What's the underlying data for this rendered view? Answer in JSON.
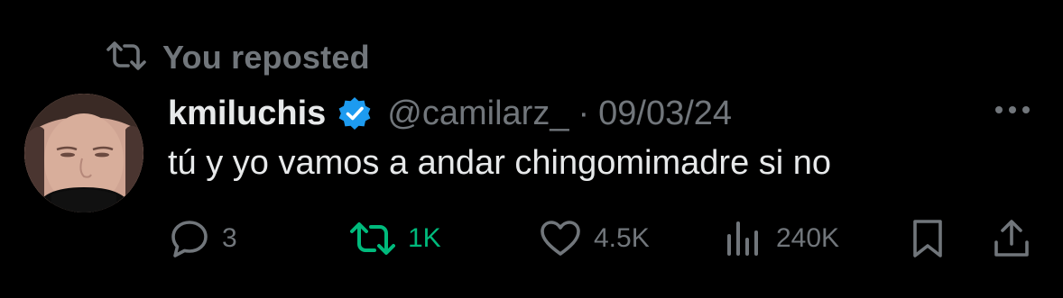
{
  "repost_banner": {
    "label": "You reposted",
    "icon": "repost-icon"
  },
  "tweet": {
    "avatar_icon": "avatar",
    "display_name": "kmiluchis",
    "verified_icon": "verified-badge-icon",
    "handle": "@camilarz_",
    "separator": "·",
    "date": "09/03/24",
    "text": "tú y yo vamos a andar chingomimadre si no",
    "more_icon": "more-icon"
  },
  "actions": {
    "reply": {
      "icon": "reply-icon",
      "count": "3"
    },
    "repost": {
      "icon": "repost-icon",
      "count": "1K",
      "active": true
    },
    "like": {
      "icon": "heart-icon",
      "count": "4.5K"
    },
    "views": {
      "icon": "views-icon",
      "count": "240K"
    },
    "bookmark": {
      "icon": "bookmark-icon"
    },
    "share": {
      "icon": "share-icon"
    }
  },
  "colors": {
    "background": "#000000",
    "text": "#e7e9ea",
    "muted": "#71767b",
    "repost_active": "#00ba7c",
    "verified": "#1d9bf0"
  }
}
